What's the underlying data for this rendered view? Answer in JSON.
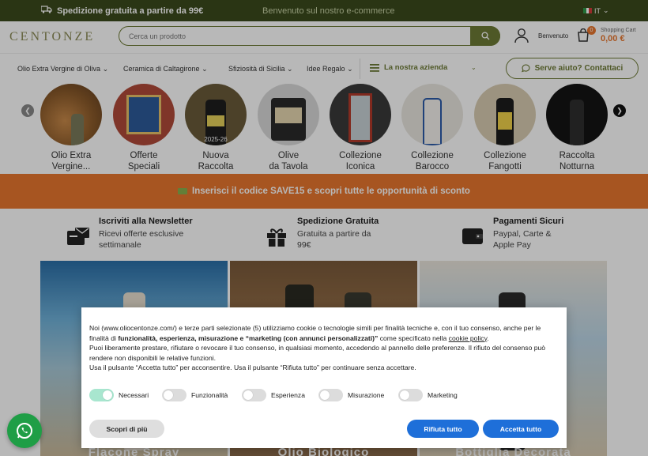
{
  "topbar": {
    "shipping": "Spedizione gratuita a partire da 99€",
    "welcome": "Benvenuto sul nostro e-commerce",
    "language": "IT"
  },
  "header": {
    "logo": "CENTONZE",
    "search_placeholder": "Cerca un prodotto",
    "account_label": "Benvenuto",
    "cart_count": "0",
    "cart_label": "Shopping Cart",
    "cart_total": "0,00 €"
  },
  "nav": {
    "items": [
      "Olio Extra Vergine di Oliva",
      "Ceramica di Caltagirone",
      "Sfiziosità di Sicilia",
      "Idee Regalo"
    ],
    "company": "La nostra azienda",
    "help": "Serve aiuto? Contattaci"
  },
  "categories": [
    {
      "line1": "Olio Extra",
      "line2": "Vergine..."
    },
    {
      "line1": "Offerte",
      "line2": "Speciali"
    },
    {
      "line1": "Nuova",
      "line2": "Raccolta",
      "badge": "2025-26"
    },
    {
      "line1": "Olive",
      "line2": "da Tavola"
    },
    {
      "line1": "Collezione",
      "line2": "Iconica"
    },
    {
      "line1": "Collezione",
      "line2": "Barocco"
    },
    {
      "line1": "Collezione",
      "line2": "Fangotti"
    },
    {
      "line1": "Raccolta",
      "line2": "Notturna"
    }
  ],
  "promo": "Inserisci il codice SAVE15 e scopri tutte le opportunità di sconto",
  "features": [
    {
      "title": "Iscriviti alla Newsletter",
      "desc": "Ricevi offerte esclusive settimanale"
    },
    {
      "title": "Spedizione Gratuita",
      "desc": "Gratuita a partire da 99€"
    },
    {
      "title": "Pagamenti Sicuri",
      "desc": "Paypal, Carte & Apple Pay"
    }
  ],
  "products": [
    "Flacone Spray",
    "Olio Biologico",
    "Bottiglia Decorata"
  ],
  "cookie": {
    "p1_a": "Noi (www.oliocentonze.com/) e terze parti selezionate (5) utilizziamo cookie o tecnologie simili per finalità tecniche e, con il tuo consenso, anche per le finalità di ",
    "p1_b": "funzionalità, esperienza, misurazione e “marketing (con annunci personalizzati)”",
    "p1_c": " come specificato nella ",
    "p1_link": "cookie policy",
    "p1_d": ".",
    "p2": "Puoi liberamente prestare, rifiutare o revocare il tuo consenso, in qualsiasi momento, accedendo al pannello delle preferenze. Il rifiuto del consenso può rendere non disponibili le relative funzioni.",
    "p3": "Usa il pulsante “Accetta tutto” per acconsentire. Usa il pulsante “Rifiuta tutto” per continuare senza accettare.",
    "toggles": [
      {
        "label": "Necessari",
        "on": true
      },
      {
        "label": "Funzionalità",
        "on": false
      },
      {
        "label": "Esperienza",
        "on": false
      },
      {
        "label": "Misurazione",
        "on": false
      },
      {
        "label": "Marketing",
        "on": false
      }
    ],
    "more": "Scopri di più",
    "reject": "Rifiuta tutto",
    "accept": "Accetta tutto"
  },
  "colors": {
    "topbar": "#3b4a1c",
    "olive": "#6d7a35",
    "orange": "#e8772e",
    "blue": "#1e6fd9",
    "whatsapp": "#1f9e46"
  }
}
